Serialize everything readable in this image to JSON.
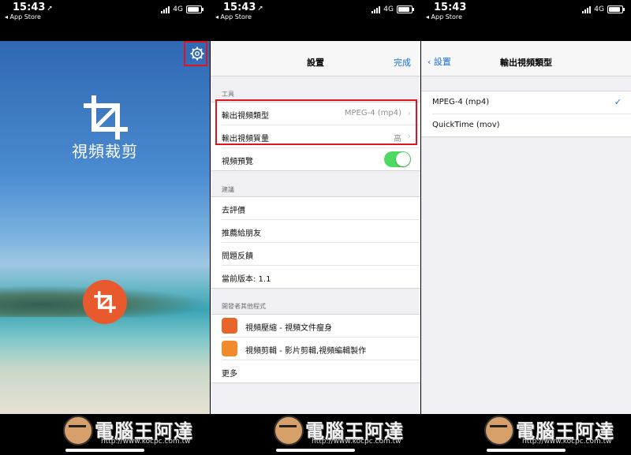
{
  "status_bar": {
    "time": "15:43",
    "back_app": "◂ App Store",
    "network": "4G"
  },
  "home_screen": {
    "app_title": "視頻裁剪"
  },
  "settings": {
    "nav_title": "設置",
    "done_label": "完成",
    "tools_header": "工具",
    "tools_rows": [
      {
        "label": "輸出視頻類型",
        "value": "MPEG-4 (mp4)"
      },
      {
        "label": "輸出視頻質量",
        "value": "高"
      },
      {
        "label": "視頻預覽",
        "toggle": true
      }
    ],
    "suggest_header": "建議",
    "suggest_rows": [
      "去評價",
      "推薦給朋友",
      "問題反饋",
      "當前版本: 1.1"
    ],
    "dev_header": "開發者其他程式",
    "dev_rows": [
      "視頻壓縮 - 視頻文件瘦身",
      "視頻剪輯 - 影片剪輯,視頻編輯製作",
      "更多"
    ]
  },
  "video_type": {
    "back_label": "設置",
    "nav_title": "輸出視頻類型",
    "options": [
      "MPEG-4 (mp4)",
      "QuickTime (mov)"
    ],
    "selected": "MPEG-4 (mp4)"
  },
  "watermark": {
    "text": "電腦王阿達",
    "url": "http://www.kocpc.com.tw"
  },
  "colors": {
    "accent_blue": "#1a6fe0",
    "highlight_red": "#e0141e",
    "fab_orange": "#e85a2e",
    "toggle_green": "#4cd964"
  }
}
